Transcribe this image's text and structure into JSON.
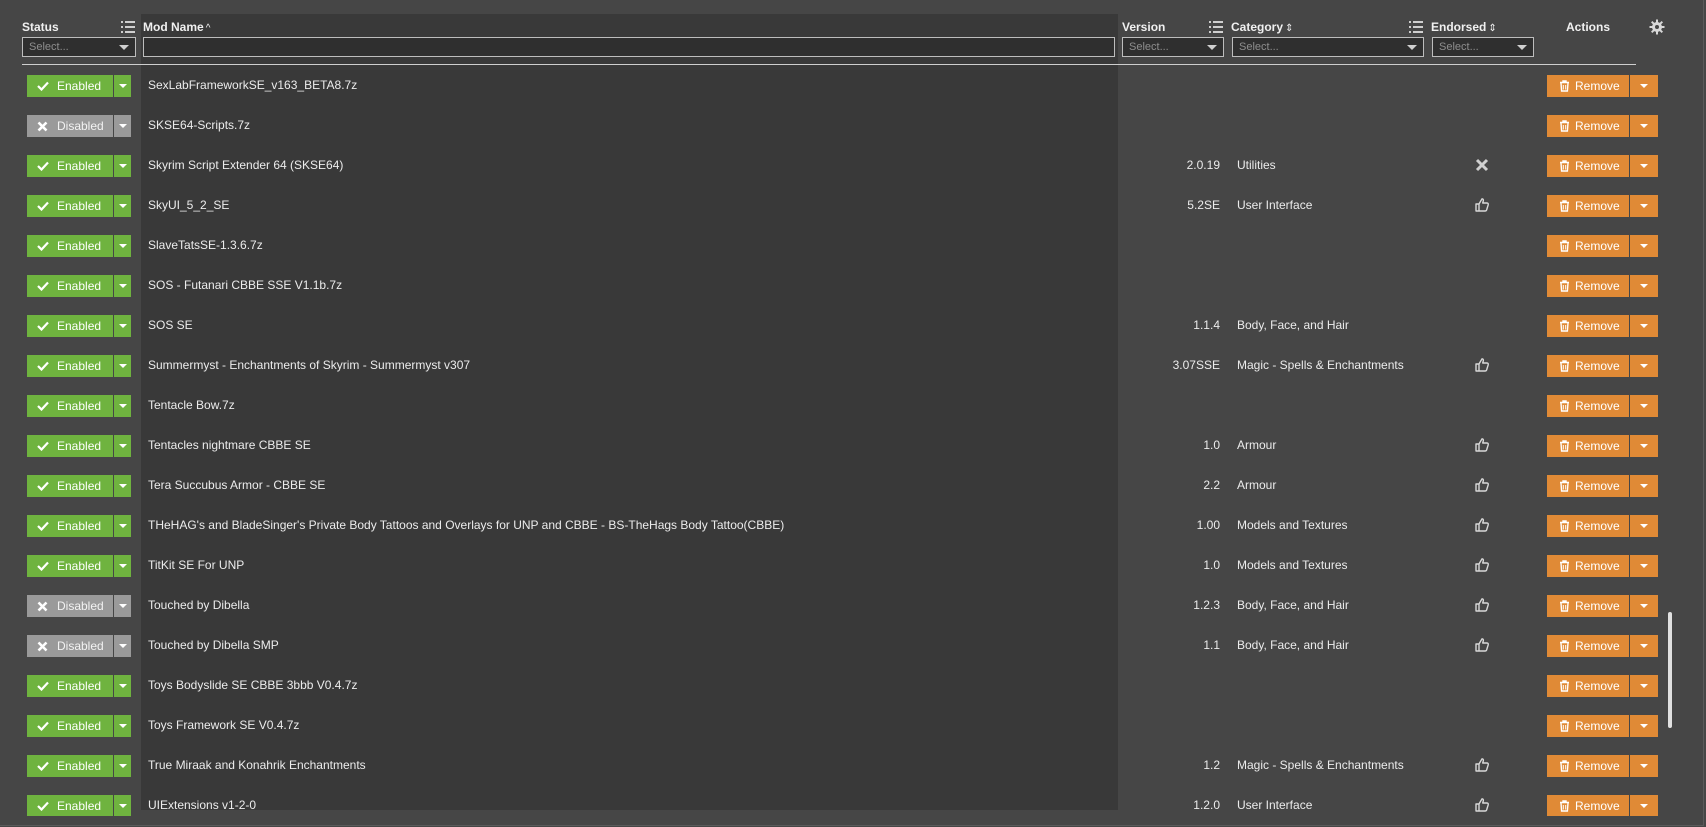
{
  "columns": {
    "status": "Status",
    "mod_name": "Mod Name",
    "mod_name_sort": "^",
    "version": "Version",
    "category": "Category",
    "category_sort": "⇕",
    "endorsed": "Endorsed",
    "endorsed_sort": "⇕",
    "actions": "Actions"
  },
  "filters": {
    "status_placeholder": "Select...",
    "mod_name_value": "",
    "version_placeholder": "Select...",
    "category_placeholder": "Select...",
    "endorsed_placeholder": "Select..."
  },
  "colors": {
    "enabled": "#6fb33f",
    "disabled": "#9a9a9a",
    "remove": "#e08a36",
    "background": "#464646",
    "name_column": "#393939"
  },
  "action_label": "Remove",
  "rows": [
    {
      "status": "Enabled",
      "name": "SexLabFrameworkSE_v163_BETA8.7z",
      "version": "",
      "category": "",
      "endorsed": ""
    },
    {
      "status": "Disabled",
      "name": "SKSE64-Scripts.7z",
      "version": "",
      "category": "",
      "endorsed": ""
    },
    {
      "status": "Enabled",
      "name": "Skyrim Script Extender 64 (SKSE64)",
      "version": "2.0.19",
      "category": "Utilities",
      "endorsed": "x-icon"
    },
    {
      "status": "Enabled",
      "name": "SkyUI_5_2_SE",
      "version": "5.2SE",
      "category": "User Interface",
      "endorsed": "thumbs-up-icon"
    },
    {
      "status": "Enabled",
      "name": "SlaveTatsSE-1.3.6.7z",
      "version": "",
      "category": "",
      "endorsed": ""
    },
    {
      "status": "Enabled",
      "name": "SOS - Futanari CBBE SSE V1.1b.7z",
      "version": "",
      "category": "",
      "endorsed": ""
    },
    {
      "status": "Enabled",
      "name": "SOS SE",
      "version": "1.1.4",
      "category": "Body, Face, and Hair",
      "endorsed": ""
    },
    {
      "status": "Enabled",
      "name": "Summermyst - Enchantments of Skyrim - Summermyst v307",
      "version": "3.07SSE",
      "category": "Magic - Spells & Enchantments",
      "endorsed": "thumbs-up-icon"
    },
    {
      "status": "Enabled",
      "name": "Tentacle Bow.7z",
      "version": "",
      "category": "",
      "endorsed": ""
    },
    {
      "status": "Enabled",
      "name": "Tentacles nightmare CBBE SE",
      "version": "1.0",
      "category": "Armour",
      "endorsed": "thumbs-up-icon"
    },
    {
      "status": "Enabled",
      "name": "Tera Succubus Armor - CBBE SE",
      "version": "2.2",
      "category": "Armour",
      "endorsed": "thumbs-up-icon"
    },
    {
      "status": "Enabled",
      "name": "THeHAG's and BladeSinger's Private Body Tattoos and Overlays for UNP and CBBE - BS-TheHags Body Tattoo(CBBE)",
      "version": "1.00",
      "category": "Models and Textures",
      "endorsed": "thumbs-up-icon"
    },
    {
      "status": "Enabled",
      "name": "TitKit SE For UNP",
      "version": "1.0",
      "category": "Models and Textures",
      "endorsed": "thumbs-up-icon"
    },
    {
      "status": "Disabled",
      "name": "Touched by Dibella",
      "version": "1.2.3",
      "category": "Body, Face, and Hair",
      "endorsed": "thumbs-up-icon"
    },
    {
      "status": "Disabled",
      "name": "Touched by Dibella SMP",
      "version": "1.1",
      "category": "Body, Face, and Hair",
      "endorsed": "thumbs-up-icon"
    },
    {
      "status": "Enabled",
      "name": "Toys Bodyslide SE CBBE 3bbb V0.4.7z",
      "version": "",
      "category": "",
      "endorsed": ""
    },
    {
      "status": "Enabled",
      "name": "Toys Framework SE V0.4.7z",
      "version": "",
      "category": "",
      "endorsed": ""
    },
    {
      "status": "Enabled",
      "name": "True Miraak and Konahrik Enchantments",
      "version": "1.2",
      "category": "Magic - Spells & Enchantments",
      "endorsed": "thumbs-up-icon"
    },
    {
      "status": "Enabled",
      "name": "UIExtensions v1-2-0",
      "version": "1.2.0",
      "category": "User Interface",
      "endorsed": "thumbs-up-icon"
    }
  ]
}
